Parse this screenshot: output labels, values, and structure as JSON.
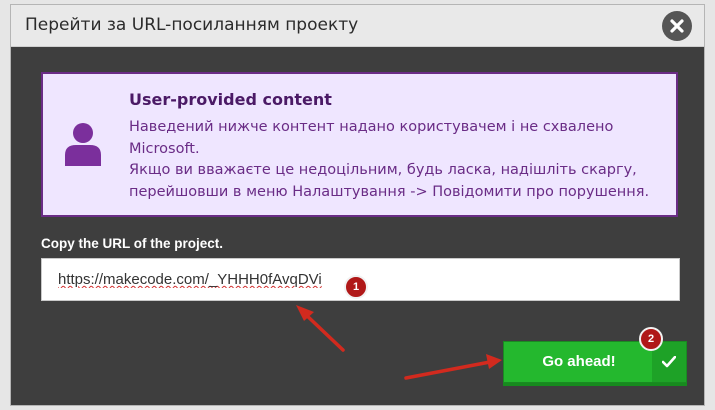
{
  "dialog": {
    "title": "Перейти за URL-посиланням проекту"
  },
  "warning": {
    "heading": "User-provided content",
    "lines": [
      "Наведений нижче контент надано користувачем і не схвалено",
      "Microsoft.",
      "Якщо ви вважаєте це недоцільним, будь ласка, надішліть скаргу,",
      "перейшовши в меню Налаштування -> Повідомити про порушення."
    ]
  },
  "url_field": {
    "label": "Copy the URL of the project.",
    "value": "https://makecode.com/_YHHH0fAvqDVi"
  },
  "annotations": {
    "badge_1": "1",
    "badge_2": "2"
  },
  "go_button": {
    "label": "Go ahead!"
  },
  "colors": {
    "dialog_bg": "#3e3e3e",
    "warning_bg": "#efe6ff",
    "warning_border": "#6a2c86",
    "button_green": "#24b82e",
    "annotation_red": "#b01818"
  },
  "icons": {
    "close": "close-icon",
    "user": "user-icon",
    "check": "checkmark-icon"
  }
}
